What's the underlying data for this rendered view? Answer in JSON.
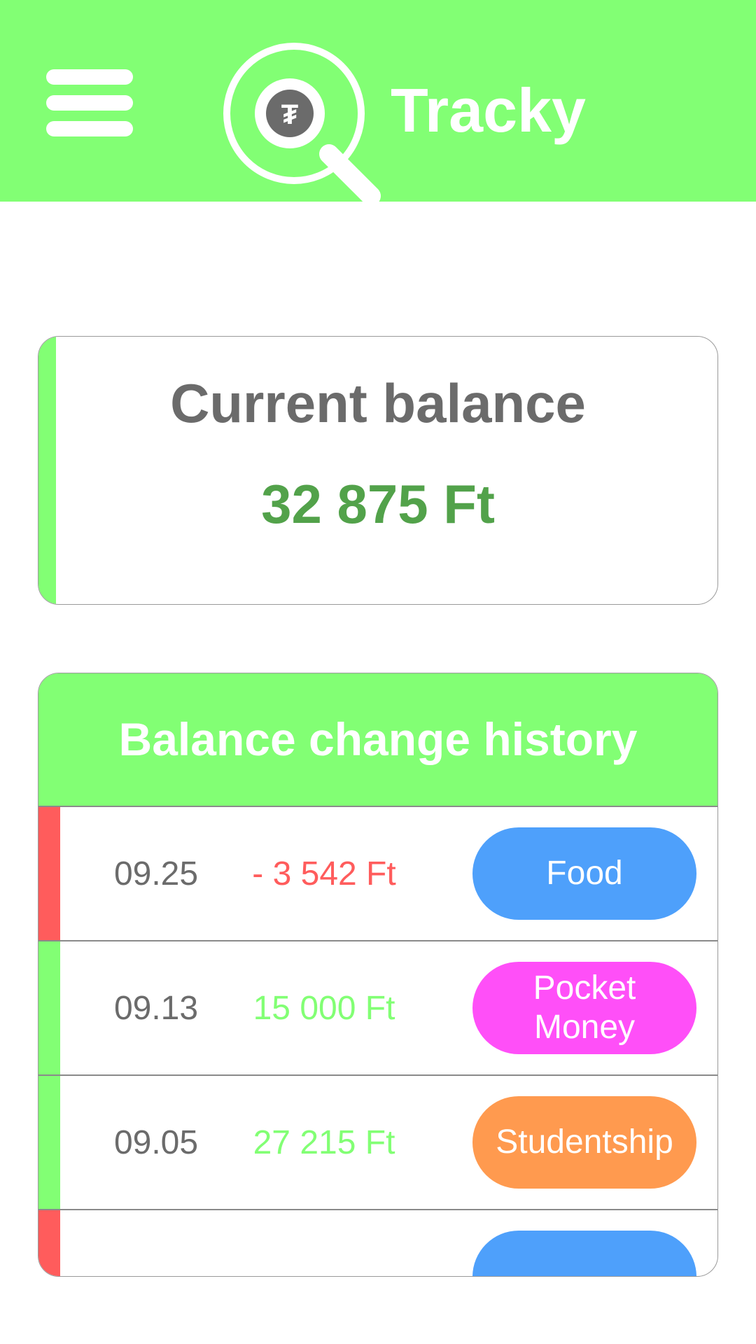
{
  "app": {
    "title": "Tracky",
    "accent_color": "#82ff74",
    "icons": {
      "menu": "hamburger-menu-icon",
      "logo": "magnifier-coin-logo"
    }
  },
  "balance": {
    "label": "Current balance",
    "value": "32 875 Ft",
    "value_color": "#52a24a"
  },
  "history": {
    "title": "Balance change history",
    "rows": [
      {
        "date": "09.25",
        "amount": "- 3 542 Ft",
        "direction": "expense",
        "amount_color": "#ff5c5c",
        "accent_color": "#ff5c5c",
        "category": "Food",
        "category_color": "#4ea0fb"
      },
      {
        "date": "09.13",
        "amount": "15 000 Ft",
        "direction": "income",
        "amount_color": "#82ff74",
        "accent_color": "#82ff74",
        "category": "Pocket Money",
        "category_color": "#ff4ff8"
      },
      {
        "date": "09.05",
        "amount": "27 215 Ft",
        "direction": "income",
        "amount_color": "#82ff74",
        "accent_color": "#82ff74",
        "category": "Studentship",
        "category_color": "#ff9a4f"
      },
      {
        "date": "",
        "amount": "",
        "direction": "expense",
        "amount_color": "#ff5c5c",
        "accent_color": "#ff5c5c",
        "category": "",
        "category_color": "#4ea0fb"
      }
    ]
  }
}
